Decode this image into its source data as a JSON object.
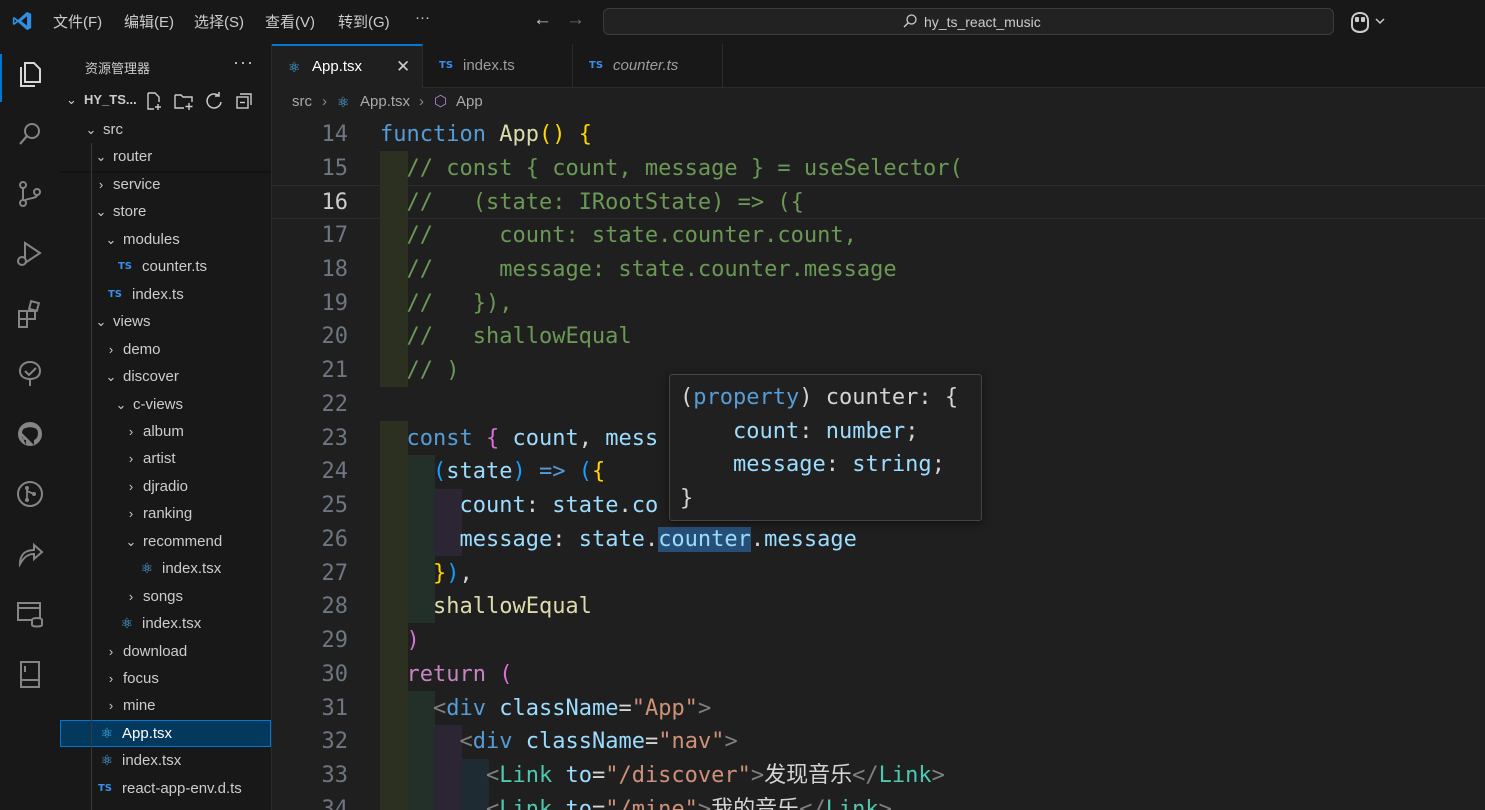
{
  "titlebar": {
    "menus": [
      "文件(F)",
      "编辑(E)",
      "选择(S)",
      "查看(V)",
      "转到(G)",
      "···"
    ],
    "search_label": "hy_ts_react_music"
  },
  "sidebar": {
    "title": "资源管理器",
    "more": "···",
    "project": "HY_TS...",
    "tree": [
      {
        "label": "src",
        "kind": "folder-open",
        "depth": 1
      },
      {
        "label": "router",
        "kind": "folder-open",
        "depth": 2
      },
      {
        "label": "service",
        "kind": "folder-closed",
        "depth": 2
      },
      {
        "label": "store",
        "kind": "folder-open",
        "depth": 2
      },
      {
        "label": "modules",
        "kind": "folder-open",
        "depth": 3
      },
      {
        "label": "counter.ts",
        "kind": "ts",
        "depth": 4
      },
      {
        "label": "index.ts",
        "kind": "ts",
        "depth": 3
      },
      {
        "label": "views",
        "kind": "folder-open",
        "depth": 2
      },
      {
        "label": "demo",
        "kind": "folder-closed",
        "depth": 3
      },
      {
        "label": "discover",
        "kind": "folder-open",
        "depth": 3
      },
      {
        "label": "c-views",
        "kind": "folder-open",
        "depth": 4
      },
      {
        "label": "album",
        "kind": "folder-closed",
        "depth": 5
      },
      {
        "label": "artist",
        "kind": "folder-closed",
        "depth": 5
      },
      {
        "label": "djradio",
        "kind": "folder-closed",
        "depth": 5
      },
      {
        "label": "ranking",
        "kind": "folder-closed",
        "depth": 5
      },
      {
        "label": "recommend",
        "kind": "folder-open",
        "depth": 5
      },
      {
        "label": "index.tsx",
        "kind": "react",
        "depth": 6
      },
      {
        "label": "songs",
        "kind": "folder-closed",
        "depth": 5
      },
      {
        "label": "index.tsx",
        "kind": "react",
        "depth": 4
      },
      {
        "label": "download",
        "kind": "folder-closed",
        "depth": 3
      },
      {
        "label": "focus",
        "kind": "folder-closed",
        "depth": 3
      },
      {
        "label": "mine",
        "kind": "folder-closed",
        "depth": 3
      },
      {
        "label": "App.tsx",
        "kind": "react",
        "depth": 2,
        "selected": true
      },
      {
        "label": "index.tsx",
        "kind": "react",
        "depth": 2
      },
      {
        "label": "react-app-env.d.ts",
        "kind": "ts",
        "depth": 2
      }
    ]
  },
  "tabs": [
    {
      "label": "App.tsx",
      "icon": "react",
      "active": true,
      "close": "✕"
    },
    {
      "label": "index.ts",
      "icon": "ts",
      "active": false
    },
    {
      "label": "counter.ts",
      "icon": "ts",
      "active": false,
      "italic": true
    }
  ],
  "breadcrumb": {
    "folder": "src",
    "file": "App.tsx",
    "symbol": "App"
  },
  "editor": {
    "current_line": 16,
    "line_numbers": [
      "14",
      "15",
      "16",
      "17",
      "18",
      "19",
      "20",
      "21",
      "22",
      "23",
      "24",
      "25",
      "26",
      "27",
      "28",
      "29",
      "30",
      "31",
      "32",
      "33",
      "34"
    ]
  },
  "hover": {
    "lines": [
      "(property) counter: {",
      "    count: number;",
      "    message: string;",
      "}"
    ]
  }
}
